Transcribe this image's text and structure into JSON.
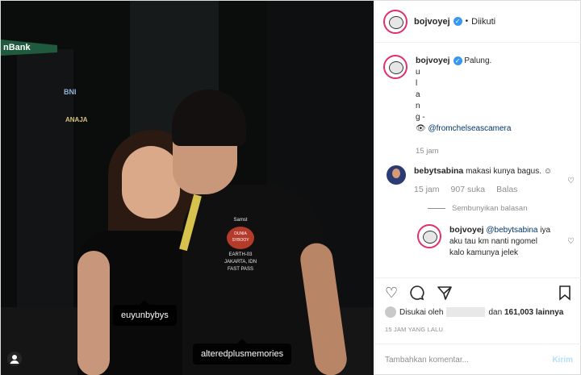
{
  "photo": {
    "signs": [
      "nBank",
      "BNI",
      "ANAJA"
    ],
    "shirt": {
      "brand": "Samst",
      "badge": "DUNIA SYBOOY",
      "line1": "EARTH-03",
      "line2": "JAKARTA, IDN",
      "line3": "FAST PASS"
    },
    "tags": [
      "euyunbybys",
      "alteredplusmemories"
    ]
  },
  "header": {
    "username": "bojvoyej",
    "follow_status": "Diikuti"
  },
  "caption": {
    "username": "bojvoyej",
    "text": "Palung.",
    "letters": [
      "u",
      "l",
      "a",
      "n",
      "g -"
    ],
    "credit_prefix": "👁",
    "credit": "@fromchelseascamera",
    "time": "15 jam"
  },
  "comment": {
    "username": "bebytsabina",
    "text": "makasi kunya bagus. ☺",
    "time": "15 jam",
    "likes": "907 suka",
    "reply_label": "Balas",
    "hide_replies": "Sembunyikan balasan"
  },
  "reply": {
    "username": "bojvoyej",
    "mention": "@bebytsabina",
    "text": "iya aku tau km nanti ngomel kalo kamunya jelek"
  },
  "likes": {
    "prefix": "Disukai oleh",
    "middle": "dan",
    "count": "161,003",
    "suffix": "lainnya"
  },
  "date": "15 JAM YANG LALU",
  "add_comment": {
    "placeholder": "Tambahkan komentar...",
    "post_label": "Kirim"
  }
}
